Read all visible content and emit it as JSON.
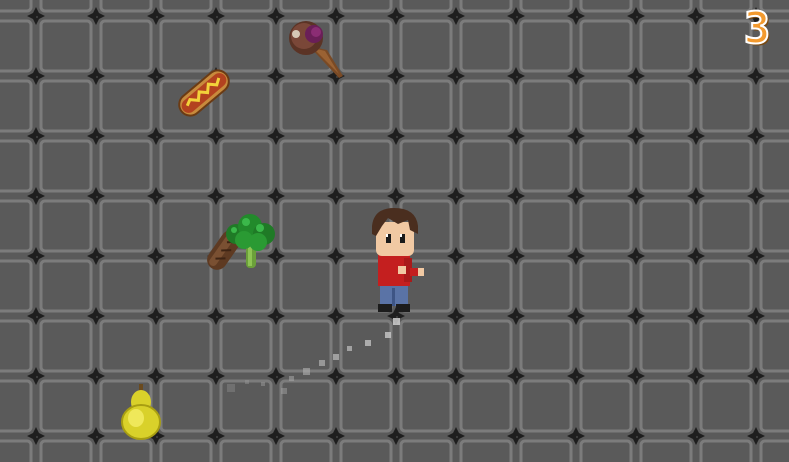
{
  "hud": {
    "score": "3",
    "score_color": "#f39a2e"
  },
  "floor": {
    "tile_color": "#5a5a5a",
    "grout_color": "#7c7c7c",
    "stud_color": "#1e1e1e"
  },
  "player": {
    "name": "player-boy",
    "shirt_color": "#c41f1f",
    "pants_color": "#5a73a6",
    "hair_color": "#4a2e1f"
  },
  "items": [
    {
      "name": "ice-cream-cone",
      "kind": "food"
    },
    {
      "name": "hot-dog",
      "kind": "food"
    },
    {
      "name": "broccoli",
      "kind": "food"
    },
    {
      "name": "sausage",
      "kind": "food"
    },
    {
      "name": "pear",
      "kind": "food"
    }
  ],
  "trail": {
    "particle_count": 12,
    "color": "#b8b8b8"
  }
}
